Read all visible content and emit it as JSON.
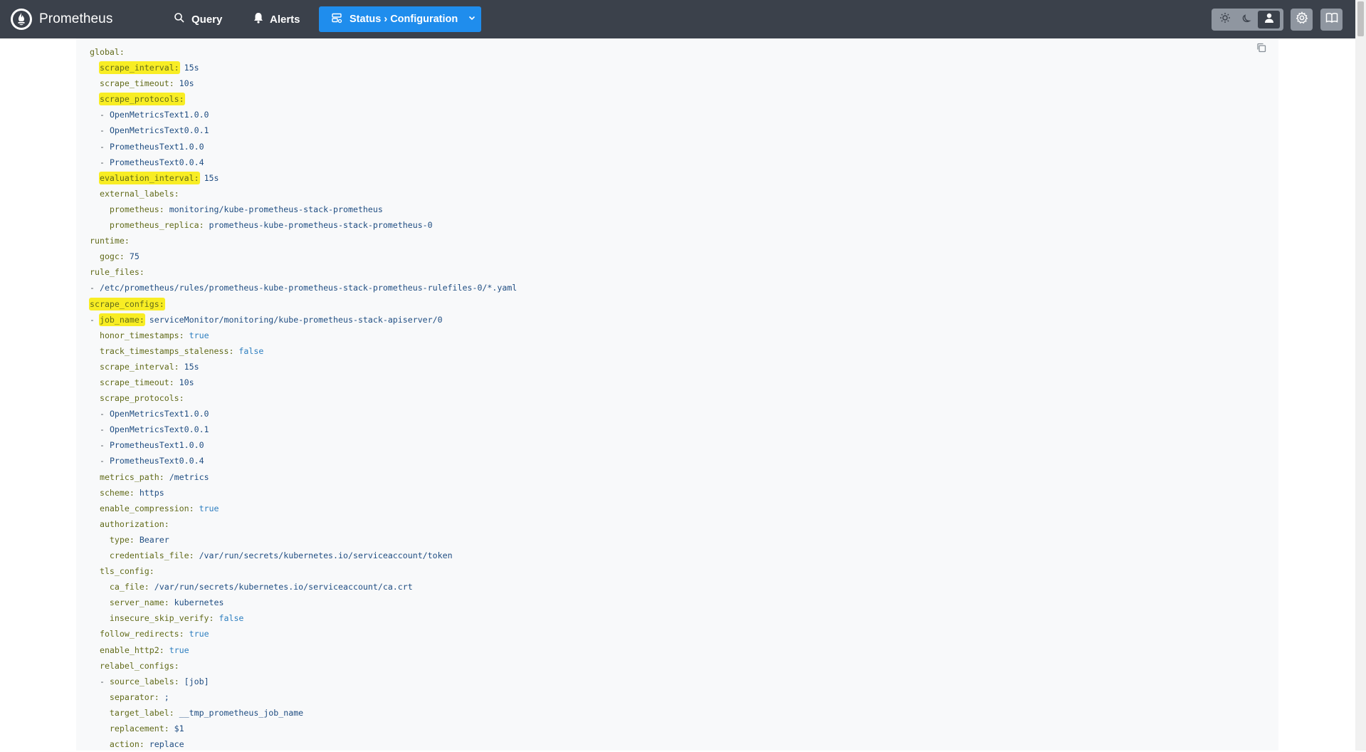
{
  "header": {
    "brand": "Prometheus",
    "nav": {
      "query": "Query",
      "alerts": "Alerts",
      "status": "Status › Configuration"
    },
    "icons": [
      "sun-icon",
      "moon-icon",
      "user-icon",
      "gear-icon",
      "book-icon"
    ]
  },
  "colors": {
    "header_bg": "#3b414b",
    "accent": "#1f8ded",
    "yaml_key": "#626b1a",
    "yaml_value": "#1f4d82",
    "yaml_bool": "#2e7fc0",
    "highlight": "#f8ed24"
  },
  "config_lines": [
    {
      "i": 0,
      "k": "global",
      "hl": false
    },
    {
      "i": 1,
      "k": "scrape_interval",
      "v": "15s",
      "hl": true
    },
    {
      "i": 1,
      "k": "scrape_timeout",
      "v": "10s",
      "hl": false
    },
    {
      "i": 1,
      "k": "scrape_protocols",
      "hl": true
    },
    {
      "i": 1,
      "d": "OpenMetricsText1.0.0"
    },
    {
      "i": 1,
      "d": "OpenMetricsText0.0.1"
    },
    {
      "i": 1,
      "d": "PrometheusText1.0.0"
    },
    {
      "i": 1,
      "d": "PrometheusText0.0.4"
    },
    {
      "i": 1,
      "k": "evaluation_interval",
      "v": "15s",
      "hl": true
    },
    {
      "i": 1,
      "k": "external_labels",
      "hl": false
    },
    {
      "i": 2,
      "k": "prometheus",
      "v": "monitoring/kube-prometheus-stack-prometheus"
    },
    {
      "i": 2,
      "k": "prometheus_replica",
      "v": "prometheus-kube-prometheus-stack-prometheus-0"
    },
    {
      "i": 0,
      "k": "runtime"
    },
    {
      "i": 1,
      "k": "gogc",
      "v": "75"
    },
    {
      "i": 0,
      "k": "rule_files"
    },
    {
      "i": 0,
      "d": "/etc/prometheus/rules/prometheus-kube-prometheus-stack-prometheus-rulefiles-0/*.yaml"
    },
    {
      "i": 0,
      "k": "scrape_configs",
      "hl": true
    },
    {
      "i": 0,
      "dash": true,
      "k": "job_name",
      "v": "serviceMonitor/monitoring/kube-prometheus-stack-apiserver/0",
      "hl": true
    },
    {
      "i": 1,
      "k": "honor_timestamps",
      "v": "true",
      "bool": true
    },
    {
      "i": 1,
      "k": "track_timestamps_staleness",
      "v": "false",
      "bool": true
    },
    {
      "i": 1,
      "k": "scrape_interval",
      "v": "15s"
    },
    {
      "i": 1,
      "k": "scrape_timeout",
      "v": "10s"
    },
    {
      "i": 1,
      "k": "scrape_protocols"
    },
    {
      "i": 1,
      "d": "OpenMetricsText1.0.0"
    },
    {
      "i": 1,
      "d": "OpenMetricsText0.0.1"
    },
    {
      "i": 1,
      "d": "PrometheusText1.0.0"
    },
    {
      "i": 1,
      "d": "PrometheusText0.0.4"
    },
    {
      "i": 1,
      "k": "metrics_path",
      "v": "/metrics"
    },
    {
      "i": 1,
      "k": "scheme",
      "v": "https"
    },
    {
      "i": 1,
      "k": "enable_compression",
      "v": "true",
      "bool": true
    },
    {
      "i": 1,
      "k": "authorization"
    },
    {
      "i": 2,
      "k": "type",
      "v": "Bearer"
    },
    {
      "i": 2,
      "k": "credentials_file",
      "v": "/var/run/secrets/kubernetes.io/serviceaccount/token"
    },
    {
      "i": 1,
      "k": "tls_config"
    },
    {
      "i": 2,
      "k": "ca_file",
      "v": "/var/run/secrets/kubernetes.io/serviceaccount/ca.crt"
    },
    {
      "i": 2,
      "k": "server_name",
      "v": "kubernetes"
    },
    {
      "i": 2,
      "k": "insecure_skip_verify",
      "v": "false",
      "bool": true
    },
    {
      "i": 1,
      "k": "follow_redirects",
      "v": "true",
      "bool": true
    },
    {
      "i": 1,
      "k": "enable_http2",
      "v": "true",
      "bool": true
    },
    {
      "i": 1,
      "k": "relabel_configs"
    },
    {
      "i": 1,
      "dash": true,
      "k": "source_labels",
      "v": "[job]"
    },
    {
      "i": 2,
      "k": "separator",
      "v": ";"
    },
    {
      "i": 2,
      "k": "target_label",
      "v": "__tmp_prometheus_job_name"
    },
    {
      "i": 2,
      "k": "replacement",
      "v": "$1"
    },
    {
      "i": 2,
      "k": "action",
      "v": "replace"
    }
  ]
}
